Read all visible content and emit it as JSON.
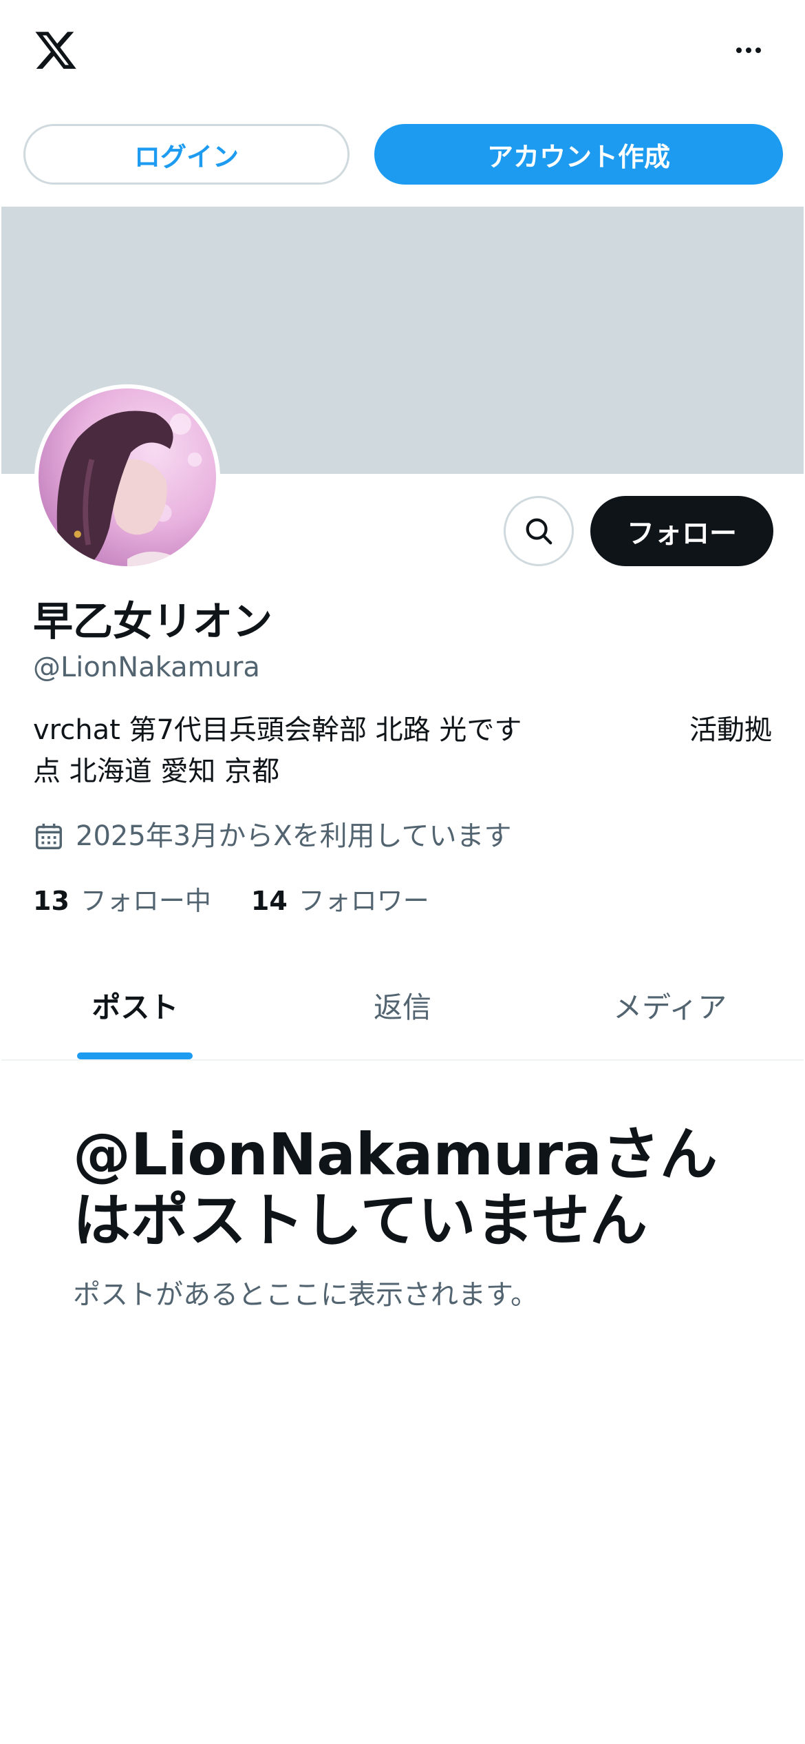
{
  "header": {
    "logo_icon": "x-logo-icon",
    "more_icon": "more-dots-icon"
  },
  "auth": {
    "login_label": "ログイン",
    "signup_label": "アカウント作成"
  },
  "profile": {
    "display_name": "早乙女リオン",
    "handle": "@LionNakamura",
    "bio_part1": "vrchat 第7代目兵頭会幹部 北路 光です",
    "bio_part2": "活動拠",
    "bio_line2": "点 北海道 愛知 京都",
    "joined": "2025年3月からXを利用しています",
    "following_count": "13",
    "following_label": "フォロー中",
    "followers_count": "14",
    "followers_label": "フォロワー",
    "follow_button": "フォロー",
    "search_icon": "search-icon",
    "calendar_icon": "calendar-icon"
  },
  "tabs": [
    {
      "label": "ポスト",
      "active": true
    },
    {
      "label": "返信",
      "active": false
    },
    {
      "label": "メディア",
      "active": false
    }
  ],
  "empty_state": {
    "title": "@LionNakamuraさんはポストしていません",
    "subtitle": "ポストがあるとここに表示されます。"
  },
  "colors": {
    "accent": "#1d9bf0",
    "text_primary": "#0f1419",
    "text_secondary": "#536471",
    "banner": "#cfd9de",
    "follow_button": "#0f1419"
  }
}
